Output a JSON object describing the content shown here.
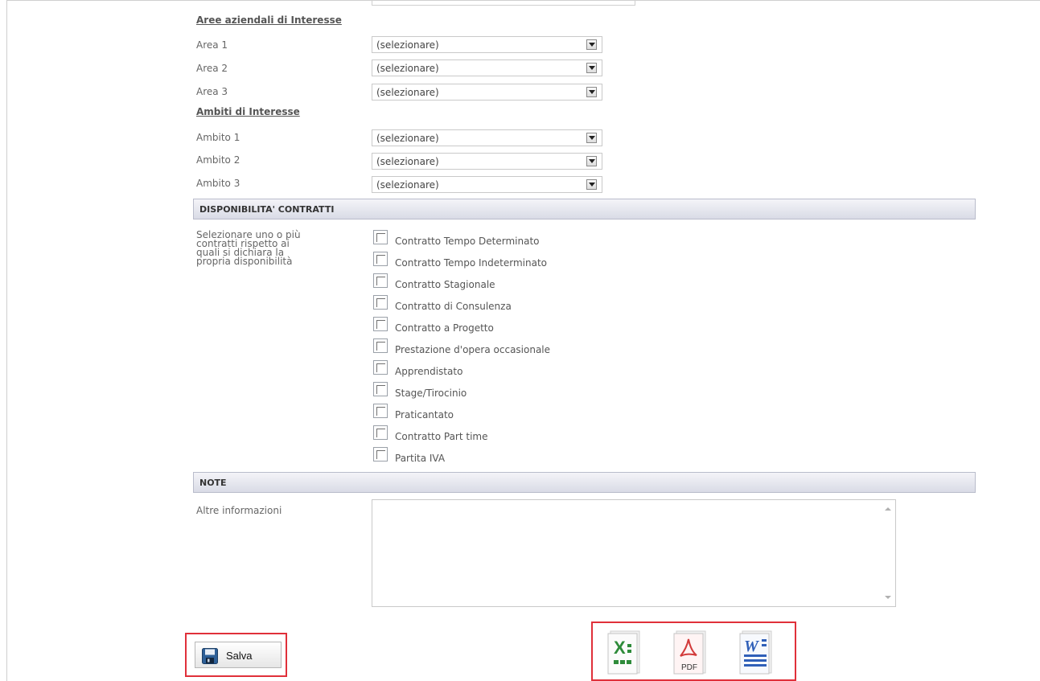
{
  "interests": {
    "areas_title": "Aree aziendali di Interesse",
    "areas": [
      {
        "label": "Area 1",
        "value": "(selezionare)"
      },
      {
        "label": "Area 2",
        "value": "(selezionare)"
      },
      {
        "label": "Area 3",
        "value": "(selezionare)"
      }
    ],
    "ambiti_title": "Ambiti di Interesse",
    "ambiti": [
      {
        "label": "Ambito 1",
        "value": "(selezionare)"
      },
      {
        "label": "Ambito 2",
        "value": "(selezionare)"
      },
      {
        "label": "Ambito 3",
        "value": "(selezionare)"
      }
    ]
  },
  "contracts": {
    "header": "DISPONIBILITA' CONTRATTI",
    "help_lines": [
      "Selezionare uno o più",
      "contratti rispetto ai",
      "quali si dichiara la",
      "propria disponibilità"
    ],
    "options": [
      "Contratto Tempo Determinato",
      "Contratto Tempo Indeterminato",
      "Contratto Stagionale",
      "Contratto di Consulenza",
      "Contratto a Progetto",
      "Prestazione d'opera occasionale",
      "Apprendistato",
      "Stage/Tirocinio",
      "Praticantato",
      "Contratto Part time",
      "Partita IVA"
    ]
  },
  "notes": {
    "header": "NOTE",
    "label": "Altre informazioni"
  },
  "actions": {
    "save_label": "Salva",
    "pdf_label": "PDF",
    "icons": [
      "excel-export-icon",
      "pdf-export-icon",
      "word-export-icon"
    ]
  },
  "colors": {
    "highlight": "#e0303a",
    "bar_gradient_top": "#f4f4f8",
    "bar_gradient_bottom": "#d9dbe6"
  }
}
